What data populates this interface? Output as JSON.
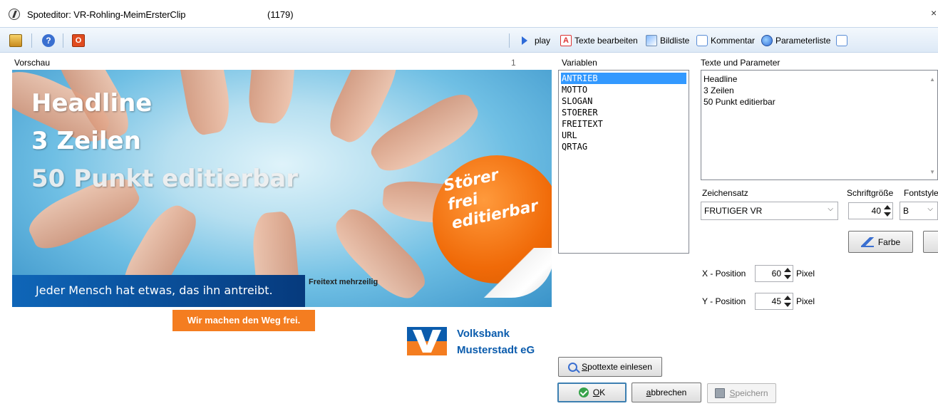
{
  "window": {
    "title": "Spoteditor: VR-Rohling-MeimErsterClip",
    "id_label": "(1179)",
    "close_glyph": "×"
  },
  "toolbar": {
    "power_glyph": "O",
    "help_glyph": "?",
    "play_label": "play",
    "texte_label": "Texte bearbeiten",
    "texte_glyph": "A",
    "bildliste_label": "Bildliste",
    "kommentar_label": "Kommentar",
    "parameterliste_label": "Parameterliste"
  },
  "preview": {
    "label": "Vorschau",
    "page_number": "1",
    "headline_lines": [
      "Headline",
      "3 Zeilen",
      "50 Punkt editierbar"
    ],
    "stoerer_lines": [
      "Störer",
      "frei",
      "editierbar"
    ],
    "claim": "Jeder Mensch hat etwas, das ihn antreibt.",
    "freitext": "Freitext mehrzeilig",
    "slogan": "Wir machen den Weg frei.",
    "bank_name_1": "Volksbank",
    "bank_name_2": "Musterstadt eG",
    "colors": {
      "brand_blue": "#0b5cad",
      "brand_orange": "#f47d20"
    }
  },
  "variables": {
    "label": "Variablen",
    "items": [
      "ANTRIEB",
      "MOTTO",
      "SLOGAN",
      "STOERER",
      "FREITEXT",
      "URL",
      "QRTAG"
    ],
    "selected": "ANTRIEB"
  },
  "texts": {
    "label": "Texte und Parameter",
    "lines": [
      "Headline",
      "3 Zeilen",
      "50 Punkt editierbar"
    ]
  },
  "font": {
    "zeichensatz_label": "Zeichensatz",
    "zeichensatz_value": "FRUTIGER VR",
    "schriftgroesse_label": "Schriftgröße",
    "schriftgroesse_value": "40",
    "fontstyle_label": "Fontstyle",
    "fontstyle_value": "B",
    "farbe_label": "Farbe"
  },
  "position": {
    "x_label": "X - Position",
    "x_value": "60",
    "y_label": "Y - Position",
    "y_value": "45",
    "unit": "Pixel"
  },
  "buttons": {
    "spottexte_first": "S",
    "spottexte_rest": "pottexte einlesen",
    "ok_first": "O",
    "ok_rest": "K",
    "abbrechen_first": "a",
    "abbrechen_rest": "bbrechen",
    "speichern_first": "S",
    "speichern_rest": "peichern"
  }
}
